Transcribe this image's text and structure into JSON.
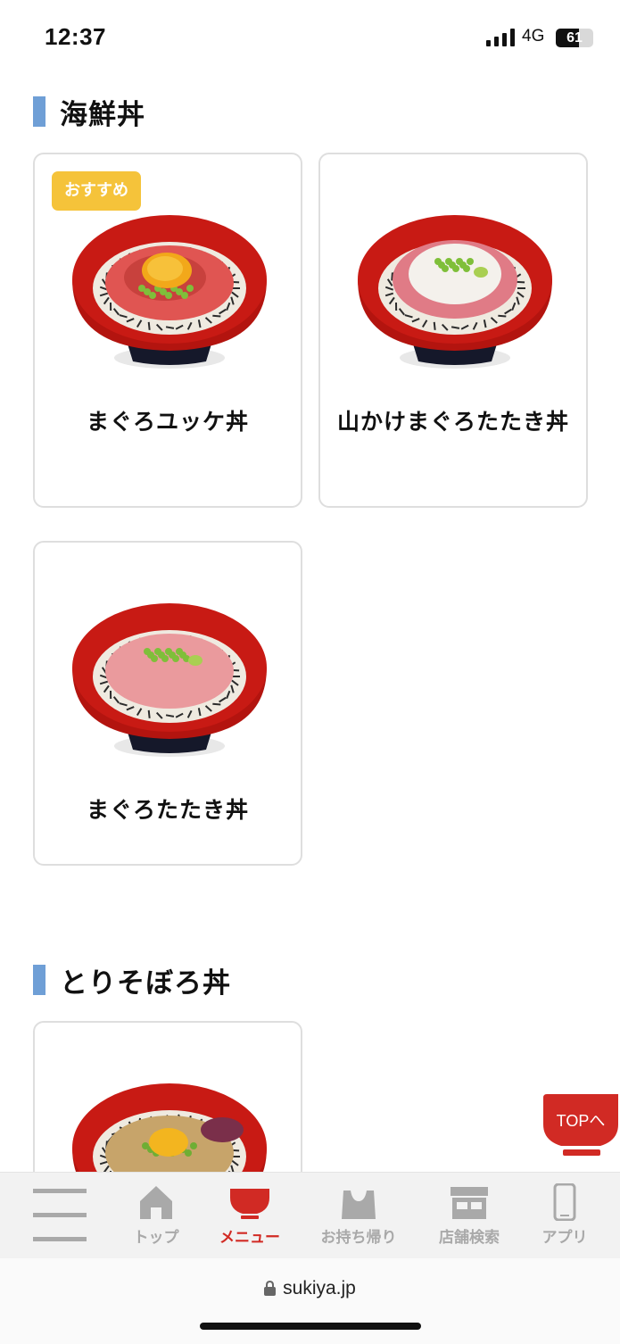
{
  "status_bar": {
    "time": "12:37",
    "network": "4G",
    "battery": "61",
    "battery_level": 0.61
  },
  "sections": [
    {
      "title": "海鮮丼",
      "items": [
        {
          "name": "まぐろユッケ丼",
          "badge": "おすすめ",
          "topping": "yukke"
        },
        {
          "name": "山かけまぐろたたき丼",
          "topping": "yamakake"
        },
        {
          "name": "まぐろたたき丼",
          "topping": "tataki"
        }
      ]
    },
    {
      "title": "とりそぼろ丼",
      "items": [
        {
          "name": "",
          "topping": "soboro"
        }
      ]
    }
  ],
  "top_button": {
    "label": "TOPへ"
  },
  "bottom_nav": {
    "menu_icon": "hamburger-icon",
    "items": [
      {
        "label": "トップ",
        "icon": "home-icon"
      },
      {
        "label": "メニュー",
        "icon": "bowl-icon",
        "active": true
      },
      {
        "label": "お持ち帰り",
        "icon": "bag-icon"
      },
      {
        "label": "店舗検索",
        "icon": "store-icon"
      },
      {
        "label": "アプリ",
        "icon": "phone-icon"
      }
    ]
  },
  "url_bar": {
    "url": "sukiya.jp"
  },
  "colors": {
    "accent_red": "#d12a24",
    "heading_bar": "#6f9fd6",
    "badge": "#f5c33a"
  }
}
